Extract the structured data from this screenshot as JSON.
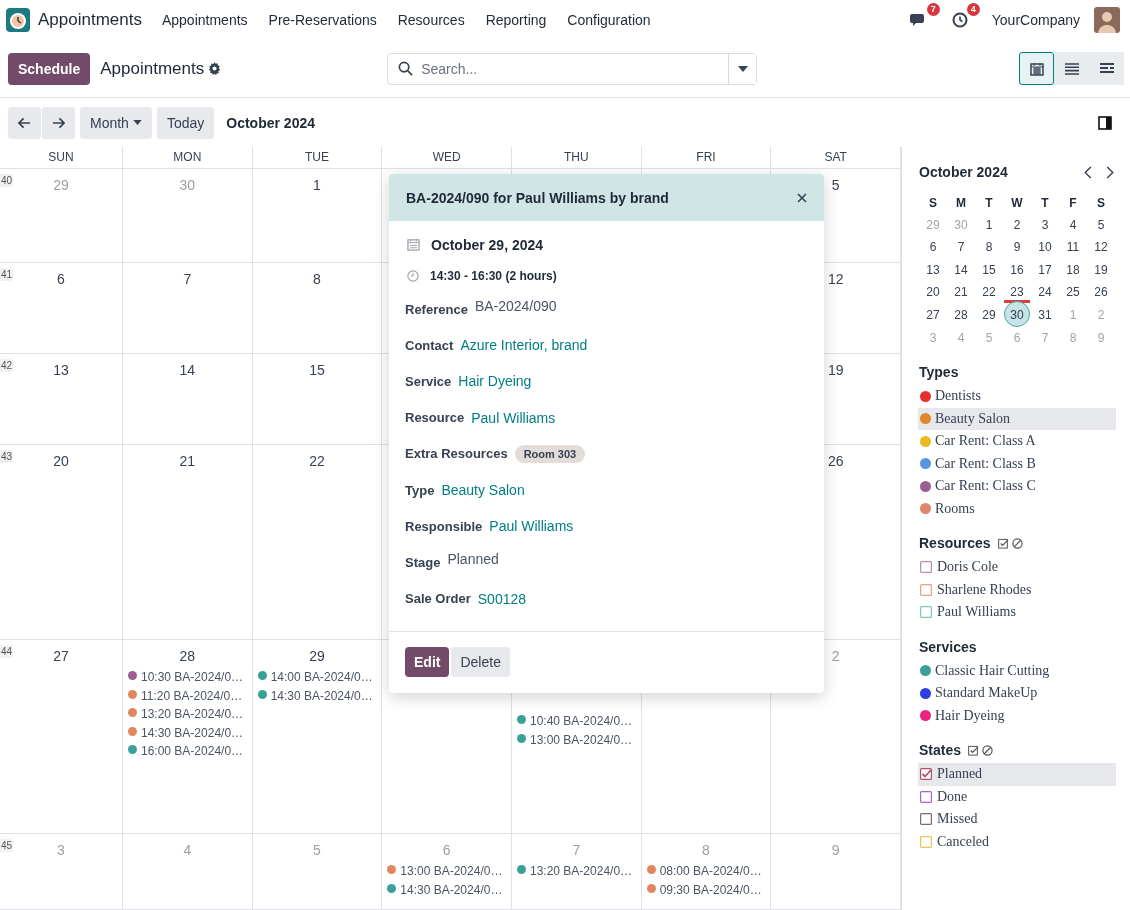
{
  "navbar": {
    "app": "Appointments",
    "menu": [
      "Appointments",
      "Pre-Reservations",
      "Resources",
      "Reporting",
      "Configuration"
    ],
    "messages_badge": "7",
    "activities_badge": "4",
    "company": "YourCompany"
  },
  "control_panel": {
    "primary_button": "Schedule",
    "title": "Appointments",
    "search": {
      "placeholder": "Search..."
    },
    "views": [
      {
        "kind": "calendar",
        "selected": true
      },
      {
        "kind": "list",
        "selected": false
      },
      {
        "kind": "gantt",
        "selected": false
      }
    ]
  },
  "toolbar": {
    "scale": "Month",
    "today": "Today",
    "period": "October 2024"
  },
  "calendar": {
    "weekdays": [
      "SUN",
      "MON",
      "TUE",
      "WED",
      "THU",
      "FRI",
      "SAT"
    ],
    "weeks": [
      {
        "number": "40",
        "days": {
          "sun": {
            "day": "29",
            "other_month": true
          },
          "mon": {
            "day": "30",
            "other_month": true
          },
          "tue": {
            "day": "1",
            "other_month": false
          },
          "sat": {
            "day": "5",
            "other_month": false
          }
        }
      },
      {
        "number": "41",
        "days": {
          "sun": {
            "day": "6",
            "other_month": false
          },
          "mon": {
            "day": "7",
            "other_month": false
          },
          "tue": {
            "day": "8",
            "other_month": false
          },
          "sat": {
            "day": "12",
            "other_month": false
          }
        }
      },
      {
        "number": "42",
        "days": {
          "sun": {
            "day": "13",
            "other_month": false
          },
          "mon": {
            "day": "14",
            "other_month": false
          },
          "tue": {
            "day": "15",
            "other_month": false
          },
          "sat": {
            "day": "19",
            "other_month": false
          }
        }
      },
      {
        "number": "43",
        "days": {
          "sun": {
            "day": "20",
            "other_month": false
          },
          "mon": {
            "day": "21",
            "other_month": false
          },
          "tue": {
            "day": "22",
            "other_month": false
          },
          "sat": {
            "day": "26",
            "other_month": false
          }
        }
      },
      {
        "number": "44",
        "days": {
          "sun": {
            "day": "27",
            "other_month": false
          },
          "mon": {
            "day": "28",
            "other_month": false,
            "events": [
              {
                "text": "10:30 BA-2024/0…",
                "color": "#9c5d94"
              },
              {
                "text": "11:20 BA-2024/0…",
                "color": "#e0875f"
              },
              {
                "text": "13:20 BA-2024/0…",
                "color": "#e0875f"
              },
              {
                "text": "14:30 BA-2024/0…",
                "color": "#e0875f"
              },
              {
                "text": "16:00 BA-2024/0…",
                "color": "#3aa198"
              }
            ]
          },
          "tue": {
            "day": "29",
            "other_month": false,
            "events": [
              {
                "text": "14:00 BA-2024/0…",
                "color": "#3aa198"
              },
              {
                "text": "14:30 BA-2024/0…",
                "color": "#3aa198"
              }
            ]
          },
          "thu": {
            "events": [
              {
                "text": "10:40 BA-2024/0…",
                "color": "#3aa198"
              },
              {
                "text": "13:00 BA-2024/0…",
                "color": "#3aa198"
              }
            ]
          },
          "sat": {
            "day": "2",
            "other_month": true
          }
        }
      },
      {
        "number": "45",
        "days": {
          "sun": {
            "day": "3",
            "other_month": true
          },
          "mon": {
            "day": "4",
            "other_month": true
          },
          "tue": {
            "day": "5",
            "other_month": true
          },
          "wed": {
            "day": "6",
            "other_month": true,
            "events": [
              {
                "text": "13:00 BA-2024/0…",
                "color": "#e0875f"
              },
              {
                "text": "14:30 BA-2024/0…",
                "color": "#3aa198"
              }
            ]
          },
          "thu": {
            "day": "7",
            "other_month": true,
            "events": [
              {
                "text": "13:20 BA-2024/0…",
                "color": "#3aa198"
              }
            ]
          },
          "fri": {
            "day": "8",
            "other_month": true,
            "events": [
              {
                "text": "08:00 BA-2024/0…",
                "color": "#e0875f"
              },
              {
                "text": "09:30 BA-2024/0…",
                "color": "#e0875f"
              }
            ]
          },
          "sat": {
            "day": "9",
            "other_month": true
          }
        }
      }
    ]
  },
  "popover": {
    "title": "BA-2024/090 for Paul Williams by brand",
    "date": "October 29, 2024",
    "time": "14:30 - 16:30 (2 hours)",
    "fields": [
      {
        "label": "Reference",
        "value": "BA-2024/090",
        "kind": "text"
      },
      {
        "label": "Contact",
        "value": "Azure Interior, brand",
        "kind": "link"
      },
      {
        "label": "Service",
        "value": "Hair Dyeing",
        "kind": "link"
      },
      {
        "label": "Resource",
        "value": "Paul Williams",
        "kind": "link"
      },
      {
        "label": "Extra Resources",
        "value": "Room 303",
        "kind": "tag"
      },
      {
        "label": "Type",
        "value": "Beauty Salon",
        "kind": "link"
      },
      {
        "label": "Responsible",
        "value": "Paul Williams",
        "kind": "link"
      },
      {
        "label": "Stage",
        "value": "Planned",
        "kind": "text"
      },
      {
        "label": "Sale Order",
        "value": "S00128",
        "kind": "link"
      }
    ],
    "buttons": [
      "Edit",
      "Delete"
    ]
  },
  "mini_calendar": {
    "title": "October 2024",
    "weekdays": [
      "S",
      "M",
      "T",
      "W",
      "T",
      "F",
      "S"
    ],
    "days": [
      {
        "label": "29",
        "muted": true,
        "selected": false,
        "marked": false
      },
      {
        "label": "30",
        "muted": true,
        "selected": false,
        "marked": false
      },
      {
        "label": "1",
        "muted": false,
        "selected": false,
        "marked": false
      },
      {
        "label": "2",
        "muted": false,
        "selected": false,
        "marked": false
      },
      {
        "label": "3",
        "muted": false,
        "selected": false,
        "marked": false
      },
      {
        "label": "4",
        "muted": false,
        "selected": false,
        "marked": false
      },
      {
        "label": "5",
        "muted": false,
        "selected": false,
        "marked": false
      },
      {
        "label": "6",
        "muted": false,
        "selected": false,
        "marked": false
      },
      {
        "label": "7",
        "muted": false,
        "selected": false,
        "marked": false
      },
      {
        "label": "8",
        "muted": false,
        "selected": false,
        "marked": false
      },
      {
        "label": "9",
        "muted": false,
        "selected": false,
        "marked": false
      },
      {
        "label": "10",
        "muted": false,
        "selected": false,
        "marked": false
      },
      {
        "label": "11",
        "muted": false,
        "selected": false,
        "marked": false
      },
      {
        "label": "12",
        "muted": false,
        "selected": false,
        "marked": false
      },
      {
        "label": "13",
        "muted": false,
        "selected": false,
        "marked": false
      },
      {
        "label": "14",
        "muted": false,
        "selected": false,
        "marked": false
      },
      {
        "label": "15",
        "muted": false,
        "selected": false,
        "marked": false
      },
      {
        "label": "16",
        "muted": false,
        "selected": false,
        "marked": false
      },
      {
        "label": "17",
        "muted": false,
        "selected": false,
        "marked": false
      },
      {
        "label": "18",
        "muted": false,
        "selected": false,
        "marked": false
      },
      {
        "label": "19",
        "muted": false,
        "selected": false,
        "marked": false
      },
      {
        "label": "20",
        "muted": false,
        "selected": false,
        "marked": false
      },
      {
        "label": "21",
        "muted": false,
        "selected": false,
        "marked": false
      },
      {
        "label": "22",
        "muted": false,
        "selected": false,
        "marked": false
      },
      {
        "label": "23",
        "muted": false,
        "selected": false,
        "marked": true
      },
      {
        "label": "24",
        "muted": false,
        "selected": false,
        "marked": false
      },
      {
        "label": "25",
        "muted": false,
        "selected": false,
        "marked": false
      },
      {
        "label": "26",
        "muted": false,
        "selected": false,
        "marked": false
      },
      {
        "label": "27",
        "muted": false,
        "selected": false,
        "marked": false
      },
      {
        "label": "28",
        "muted": false,
        "selected": false,
        "marked": false
      },
      {
        "label": "29",
        "muted": false,
        "selected": false,
        "marked": false
      },
      {
        "label": "30",
        "muted": false,
        "selected": true,
        "marked": false
      },
      {
        "label": "31",
        "muted": false,
        "selected": false,
        "marked": false
      },
      {
        "label": "1",
        "muted": true,
        "selected": false,
        "marked": false
      },
      {
        "label": "2",
        "muted": true,
        "selected": false,
        "marked": false
      },
      {
        "label": "3",
        "muted": true,
        "selected": false,
        "marked": false
      },
      {
        "label": "4",
        "muted": true,
        "selected": false,
        "marked": false
      },
      {
        "label": "5",
        "muted": true,
        "selected": false,
        "marked": false
      },
      {
        "label": "6",
        "muted": true,
        "selected": false,
        "marked": false
      },
      {
        "label": "7",
        "muted": true,
        "selected": false,
        "marked": false
      },
      {
        "label": "8",
        "muted": true,
        "selected": false,
        "marked": false
      },
      {
        "label": "9",
        "muted": true,
        "selected": false,
        "marked": false
      }
    ]
  },
  "filters": [
    {
      "title": "Types",
      "toggles": false,
      "kind": "dot",
      "items": [
        {
          "label": "Dentists",
          "color": "#e52f2f",
          "highlighted": false
        },
        {
          "label": "Beauty Salon",
          "color": "#e0862e",
          "highlighted": true
        },
        {
          "label": "Car Rent: Class A",
          "color": "#e8b922",
          "highlighted": false
        },
        {
          "label": "Car Rent: Class B",
          "color": "#5b95e0",
          "highlighted": false
        },
        {
          "label": "Car Rent: Class C",
          "color": "#9c5d94",
          "highlighted": false
        },
        {
          "label": "Rooms",
          "color": "#e0866a",
          "highlighted": false
        }
      ]
    },
    {
      "title": "Resources",
      "toggles": true,
      "kind": "checkbox",
      "items": [
        {
          "label": "Doris Cole",
          "color": "#b98ab6",
          "checked": false,
          "highlighted": false
        },
        {
          "label": "Sharlene Rhodes",
          "color": "#e8a088",
          "checked": false,
          "highlighted": false
        },
        {
          "label": "Paul Williams",
          "color": "#7cc8c4",
          "checked": false,
          "highlighted": false
        }
      ]
    },
    {
      "title": "Services",
      "toggles": false,
      "kind": "dot",
      "items": [
        {
          "label": "Classic Hair Cutting",
          "color": "#3aa198",
          "highlighted": false
        },
        {
          "label": "Standard MakeUp",
          "color": "#2e3de0",
          "highlighted": false
        },
        {
          "label": "Hair Dyeing",
          "color": "#e8247f",
          "highlighted": false
        }
      ]
    },
    {
      "title": "States",
      "toggles": true,
      "kind": "checkbox",
      "items": [
        {
          "label": "Planned",
          "color": "#b0506a",
          "checked": true,
          "highlighted": true
        },
        {
          "label": "Done",
          "color": "#a865c8",
          "checked": false,
          "highlighted": false
        },
        {
          "label": "Missed",
          "color": "#7a6a6a",
          "checked": false,
          "highlighted": false
        },
        {
          "label": "Canceled",
          "color": "#f0c060",
          "checked": false,
          "highlighted": false
        }
      ]
    }
  ]
}
